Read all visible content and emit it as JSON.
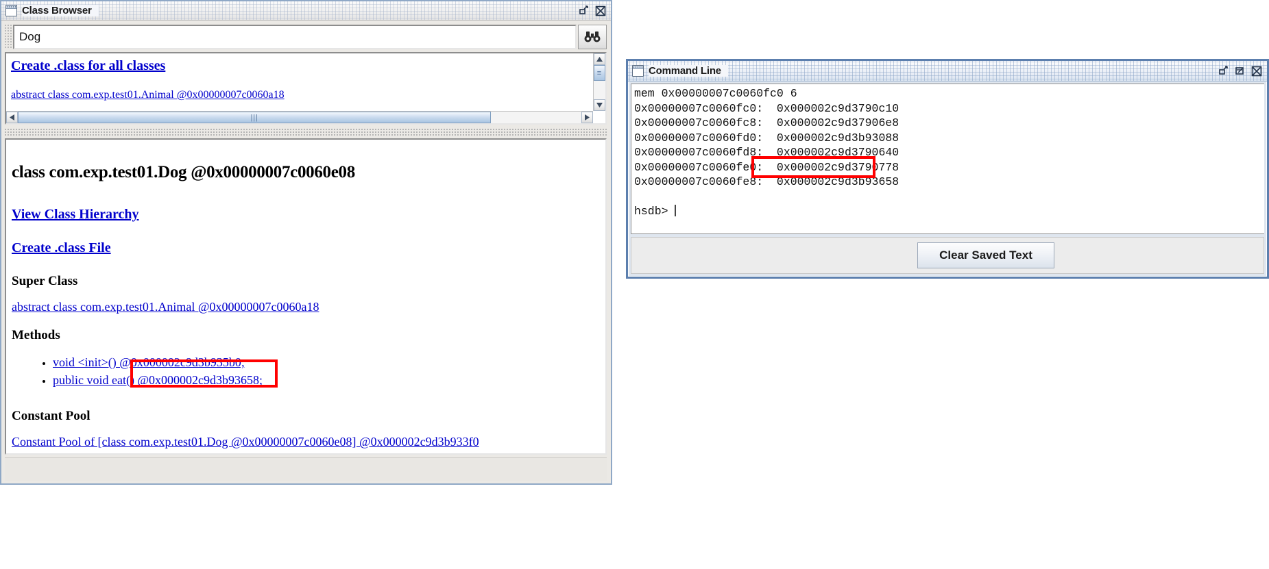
{
  "class_browser": {
    "title": "Class Browser",
    "icon": "window-icon",
    "window_buttons": [
      {
        "name": "restore-button",
        "glyph": "restore"
      },
      {
        "name": "close-button",
        "glyph": "close"
      }
    ],
    "search": {
      "value": "Dog",
      "placeholder": "",
      "button_icon": "binoculars-icon"
    },
    "tree": {
      "create_all_link": "Create .class for all classes",
      "entries": [
        "abstract class com.exp.test01.Animal @0x00000007c0060a18"
      ]
    },
    "detail": {
      "heading": "class com.exp.test01.Dog @0x00000007c0060e08",
      "view_hierarchy_link": "View Class Hierarchy",
      "create_class_file_link": "Create .class File",
      "super_class_label": "Super Class",
      "super_class_link": "abstract class com.exp.test01.Animal @0x00000007c0060a18",
      "methods_label": "Methods",
      "methods": [
        "void <init>() @0x000002c9d3b935b0;",
        "public void eat() @0x000002c9d3b93658;"
      ],
      "constant_pool_label": "Constant Pool",
      "constant_pool_link": "Constant Pool of [class com.exp.test01.Dog @0x00000007c0060e08] @0x000002c9d3b933f0"
    }
  },
  "command_line": {
    "title": "Command Line",
    "icon": "window-icon",
    "window_buttons": [
      {
        "name": "restore-button",
        "glyph": "restore"
      },
      {
        "name": "maximize-button",
        "glyph": "maximize"
      },
      {
        "name": "close-button",
        "glyph": "close"
      }
    ],
    "output": "mem 0x00000007c0060fc0 6\n0x00000007c0060fc0:  0x000002c9d3790c10\n0x00000007c0060fc8:  0x000002c9d37906e8\n0x00000007c0060fd0:  0x000002c9d3b93088\n0x00000007c0060fd8:  0x000002c9d3790640\n0x00000007c0060fe0:  0x000002c9d3790778\n0x00000007c0060fe8:  0x000002c9d3b93658\n\nhsdb> ",
    "prompt": "hsdb>",
    "clear_button": "Clear Saved Text"
  },
  "annotations": {
    "highlight_color": "#ff0000",
    "boxes": [
      {
        "name": "method-address-highlight",
        "target": "public void eat() @0x000002c9d3b93658;"
      },
      {
        "name": "memory-value-highlight",
        "target": "0x000002c9d3b93658"
      }
    ]
  },
  "colors": {
    "link": "#0000cc",
    "title_text": "#1c1c1c",
    "frame_border_active": "#5c7fae",
    "frame_border_inactive": "#8fa8c6"
  }
}
